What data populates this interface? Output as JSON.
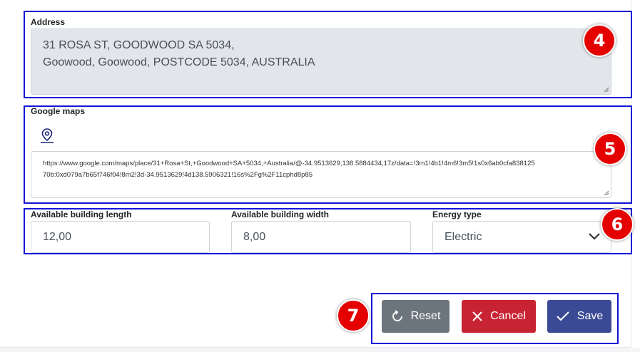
{
  "address": {
    "label": "Address",
    "value": "31 ROSA ST, GOODWOOD SA 5034,\nGoowood, Goowood, POSTCODE 5034, AUSTRALIA"
  },
  "google_maps": {
    "label": "Google maps",
    "icon": "map-pin-icon",
    "value": "https://www.google.com/maps/place/31+Rosa+St,+Goodwood+SA+5034,+Australia/@-34.9513629,138.5884434,17z/data=!3m1!4b1!4m6!3m5!1s0x6ab0cfa838125\n70b:0xd079a7b65f746f04!8m2!3d-34.9513629!4d138.5906321!16s%2Fg%2F11cphd8p85"
  },
  "dimensions": {
    "length_label": "Available building length",
    "length_value": "12,00",
    "width_label": "Available building width",
    "width_value": "8,00",
    "energy_label": "Energy type",
    "energy_value": "Electric"
  },
  "actions": {
    "reset_label": "Reset",
    "cancel_label": "Cancel",
    "save_label": "Save"
  },
  "annotations": [
    "4",
    "5",
    "6",
    "7"
  ],
  "colors": {
    "highlight": "#1313d6",
    "badge": "#e50000",
    "reset": "#6c757d",
    "cancel": "#c82333",
    "save": "#3b4a94"
  }
}
